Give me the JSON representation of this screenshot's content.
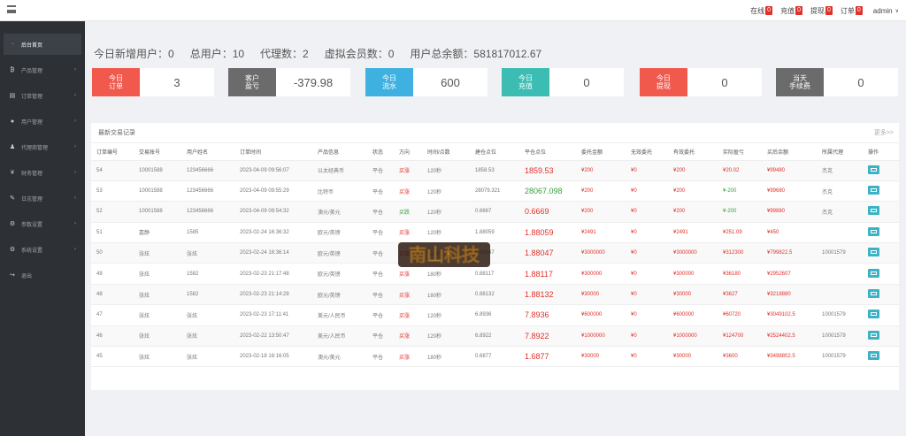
{
  "topbar": {
    "links": [
      {
        "label": "在线",
        "count": "0"
      },
      {
        "label": "充值",
        "count": "0"
      },
      {
        "label": "提现",
        "count": "0"
      },
      {
        "label": "订单",
        "count": "0"
      }
    ],
    "user": "admin"
  },
  "sidebar": {
    "items": [
      {
        "label": "后台首页",
        "icon": "dashboard-icon",
        "active": true
      },
      {
        "label": "产品管理",
        "icon": "product-icon"
      },
      {
        "label": "订单管理",
        "icon": "order-icon"
      },
      {
        "label": "用户管理",
        "icon": "user-icon"
      },
      {
        "label": "代理商管理",
        "icon": "agent-icon"
      },
      {
        "label": "财务管理",
        "icon": "finance-icon"
      },
      {
        "label": "日志管理",
        "icon": "log-icon"
      },
      {
        "label": "参数设置",
        "icon": "settings-icon"
      },
      {
        "label": "系统设置",
        "icon": "system-icon"
      },
      {
        "label": "退出",
        "icon": "logout-icon"
      }
    ]
  },
  "stats": {
    "new_users": "今日新增用户：0",
    "total_users": "总用户：10",
    "agents": "代理数：2",
    "virtual_members": "虚拟会员数：0",
    "total_balance": "用户总余额：581817012.67"
  },
  "cards": [
    {
      "label1": "今日",
      "label2": "订单",
      "value": "3",
      "color": "#f0594c"
    },
    {
      "label1": "客户",
      "label2": "盈亏",
      "value": "-379.98",
      "color": "#6b6b6b"
    },
    {
      "label1": "今日",
      "label2": "流水",
      "value": "600",
      "color": "#3fb1e0"
    },
    {
      "label1": "今日",
      "label2": "充值",
      "value": "0",
      "color": "#3bbdb3"
    },
    {
      "label1": "今日",
      "label2": "提现",
      "value": "0",
      "color": "#f0594c"
    },
    {
      "label1": "当天",
      "label2": "手续费",
      "value": "0",
      "color": "#6b6b6b"
    }
  ],
  "transactions": {
    "title": "最新交易记录",
    "more": "更多>>",
    "columns": [
      "订单编号",
      "交易账号",
      "用户姓名",
      "订单时间",
      "产品信息",
      "状态",
      "方向",
      "时间/点数",
      "建仓点位",
      "平仓点位",
      "委托金额",
      "无效委托",
      "有效委托",
      "实际盈亏",
      "买后余额",
      "所属代理",
      "操作"
    ],
    "rows": [
      {
        "id": "54",
        "account": "10001588",
        "name": "123456666",
        "time": "2023-04-09 09:56:07",
        "product": "以太经典币",
        "status": "平仓",
        "direction": "买涨",
        "duration": "120秒",
        "open": "1858.53",
        "close": "1859.53",
        "amount": "¥200",
        "invalid": "¥0",
        "valid": "¥200",
        "profit": "¥20.02",
        "balance": "¥99480",
        "agent": "杰克"
      },
      {
        "id": "53",
        "account": "10001588",
        "name": "123456666",
        "time": "2023-04-09 09:55:29",
        "product": "比特币",
        "status": "平仓",
        "direction": "买涨",
        "duration": "120秒",
        "open": "28079.321",
        "close": "28067.098",
        "amount": "¥200",
        "invalid": "¥0",
        "valid": "¥200",
        "profit": "¥-200",
        "balance": "¥99680",
        "agent": "杰克"
      },
      {
        "id": "52",
        "account": "10001588",
        "name": "123456666",
        "time": "2023-04-09 09:54:32",
        "product": "澳元/美元",
        "status": "平仓",
        "direction": "买跌",
        "duration": "120秒",
        "open": "0.6667",
        "close": "0.6669",
        "amount": "¥200",
        "invalid": "¥0",
        "valid": "¥200",
        "profit": "¥-200",
        "balance": "¥99880",
        "agent": "杰克"
      },
      {
        "id": "51",
        "account": "嘉静",
        "name": "1585",
        "time": "2023-02-24 16:36:32",
        "product": "欧元/英镑",
        "status": "平仓",
        "direction": "买涨",
        "duration": "120秒",
        "open": "1.88059",
        "close": "1.88059",
        "amount": "¥2491",
        "invalid": "¥0",
        "valid": "¥2491",
        "profit": "¥251.09",
        "balance": "¥450",
        "agent": ""
      },
      {
        "id": "50",
        "account": "张炫",
        "name": "张炫",
        "time": "2023-02-24 16:36:14",
        "product": "欧元/英镑",
        "status": "平仓",
        "direction": "买涨",
        "duration": "120秒",
        "open": "0.88047",
        "close": "1.88047",
        "amount": "¥3000000",
        "invalid": "¥0",
        "valid": "¥3000000",
        "profit": "¥312300",
        "balance": "¥799822.5",
        "agent": "10001579"
      },
      {
        "id": "49",
        "account": "张炫",
        "name": "1582",
        "time": "2023-02-23 21:17:48",
        "product": "欧元/英镑",
        "status": "平仓",
        "direction": "买涨",
        "duration": "180秒",
        "open": "0.88117",
        "close": "1.88117",
        "amount": "¥300000",
        "invalid": "¥0",
        "valid": "¥300000",
        "profit": "¥36180",
        "balance": "¥2952607",
        "agent": ""
      },
      {
        "id": "48",
        "account": "张炫",
        "name": "1582",
        "time": "2023-02-23 21:14:28",
        "product": "欧元/英镑",
        "status": "平仓",
        "direction": "买涨",
        "duration": "180秒",
        "open": "0.88132",
        "close": "1.88132",
        "amount": "¥30000",
        "invalid": "¥0",
        "valid": "¥30000",
        "profit": "¥3627",
        "balance": "¥3218880",
        "agent": ""
      },
      {
        "id": "47",
        "account": "张炫",
        "name": "张炫",
        "time": "2023-02-23 17:11:41",
        "product": "美元/人民币",
        "status": "平仓",
        "direction": "买涨",
        "duration": "120秒",
        "open": "6.8936",
        "close": "7.8936",
        "amount": "¥600000",
        "invalid": "¥0",
        "valid": "¥600000",
        "profit": "¥60720",
        "balance": "¥3049102.5",
        "agent": "10001579"
      },
      {
        "id": "46",
        "account": "张炫",
        "name": "张炫",
        "time": "2023-02-22 13:50:47",
        "product": "美元/人民币",
        "status": "平仓",
        "direction": "买涨",
        "duration": "120秒",
        "open": "6.8922",
        "close": "7.8922",
        "amount": "¥1000000",
        "invalid": "¥0",
        "valid": "¥1000000",
        "profit": "¥124700",
        "balance": "¥2524402.5",
        "agent": "10001579"
      },
      {
        "id": "45",
        "account": "张炫",
        "name": "张炫",
        "time": "2023-02-18 16:16:05",
        "product": "澳元/美元",
        "status": "平仓",
        "direction": "买涨",
        "duration": "180秒",
        "open": "0.6877",
        "close": "1.6877",
        "amount": "¥30000",
        "invalid": "¥0",
        "valid": "¥30000",
        "profit": "¥3600",
        "balance": "¥3498802.5",
        "agent": "10001579"
      }
    ]
  },
  "watermark": {
    "text": "南山科技"
  }
}
